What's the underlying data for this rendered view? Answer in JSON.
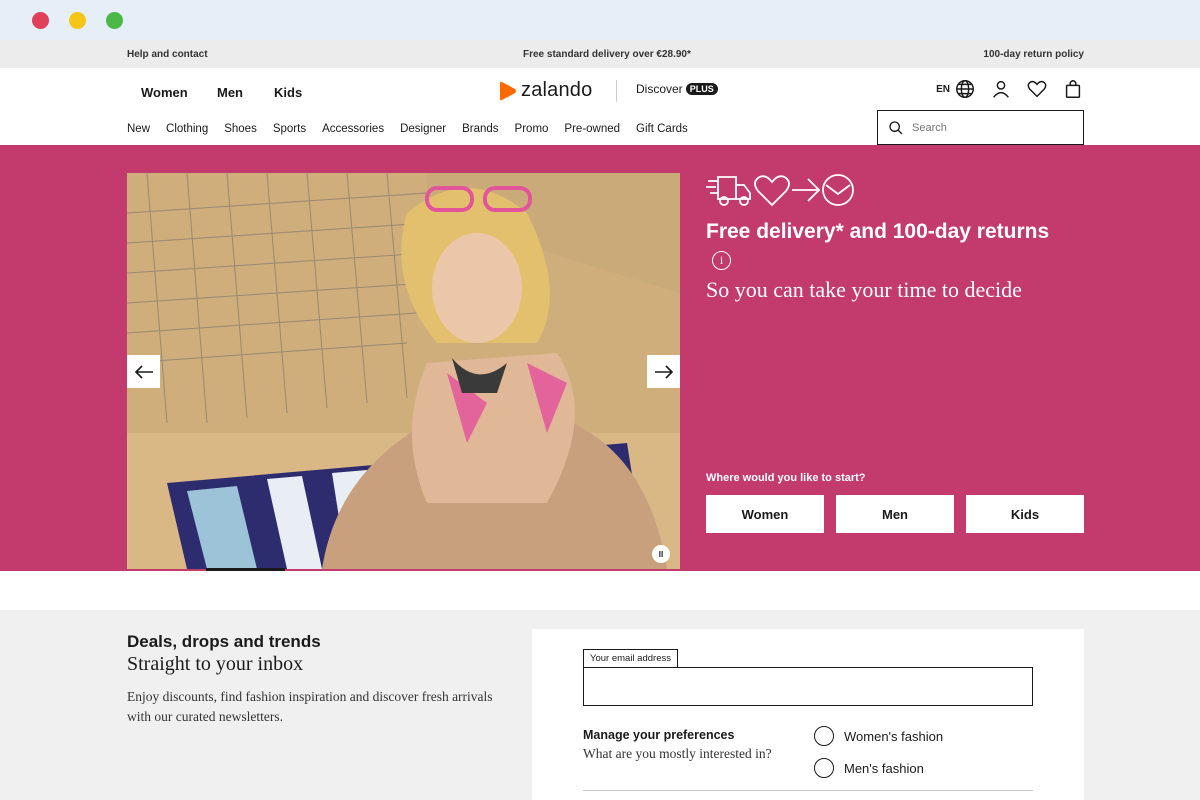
{
  "topbar": {
    "help": "Help and contact",
    "delivery": "Free standard delivery over €28.90*",
    "returns": "100-day return policy"
  },
  "header": {
    "gender_tabs": [
      "Women",
      "Men",
      "Kids"
    ],
    "logo_text": "zalando",
    "discover_label": "Discover",
    "plus_badge": "PLUS",
    "language": "EN",
    "categories": [
      "New",
      "Clothing",
      "Shoes",
      "Sports",
      "Accessories",
      "Designer",
      "Brands",
      "Promo",
      "Pre-owned",
      "Gift Cards"
    ],
    "search_placeholder": "Search"
  },
  "hero": {
    "title": "Free delivery* and 100-day returns",
    "info": "i",
    "subtitle": "So you can take your time to decide",
    "start_question": "Where would you like to start?",
    "start_buttons": [
      "Women",
      "Men",
      "Kids"
    ],
    "pause": "II"
  },
  "newsletter": {
    "title": "Deals, drops and trends",
    "subtitle": "Straight to your inbox",
    "description": "Enjoy discounts, find fashion inspiration and discover fresh arrivals with our curated newsletters.",
    "email_label": "Your email address",
    "email_value": "",
    "pref_title": "Manage your preferences",
    "pref_question": "What are you mostly interested in?",
    "options": [
      "Women's fashion",
      "Men's fashion"
    ]
  },
  "colors": {
    "hero_bg": "#c33a6c",
    "logo_orange": "#ff6900",
    "text": "#1a1a1a"
  }
}
